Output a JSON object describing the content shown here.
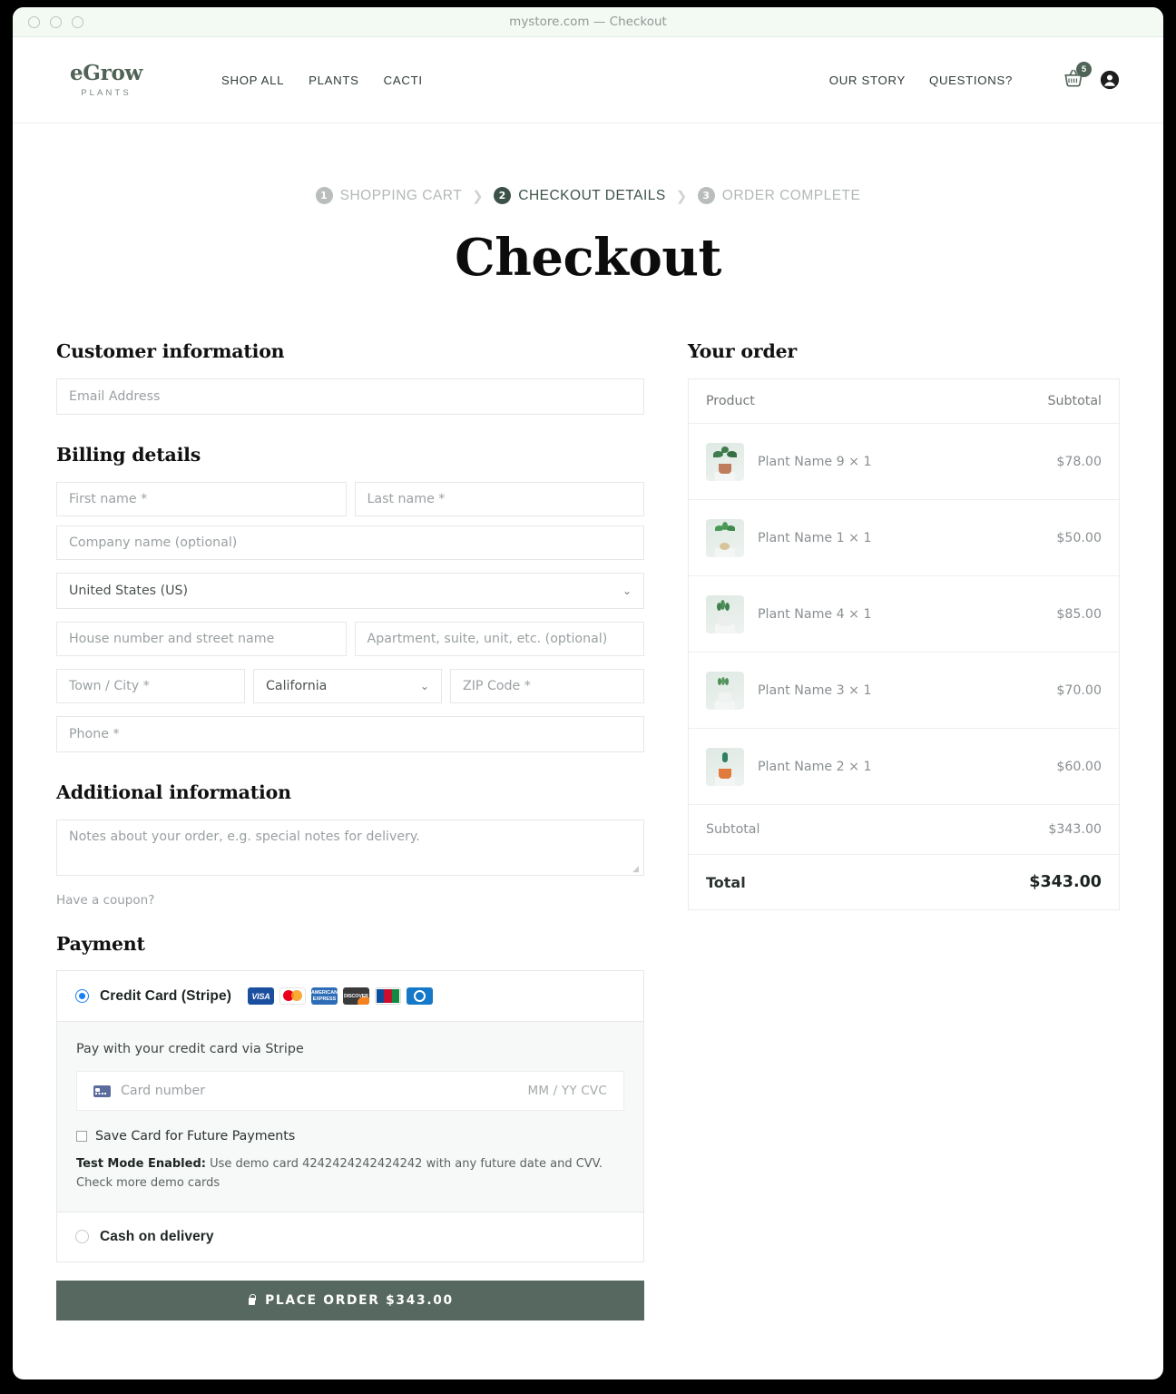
{
  "window": {
    "title": "mystore.com — Checkout"
  },
  "header": {
    "brand_name": "eGrow",
    "brand_sub": "PLANTS",
    "nav_left": [
      "SHOP ALL",
      "PLANTS",
      "CACTI"
    ],
    "nav_right": [
      "OUR STORY",
      "QUESTIONS?"
    ],
    "cart_count": "5"
  },
  "steps": [
    {
      "num": "1",
      "label": "SHOPPING CART",
      "active": false
    },
    {
      "num": "2",
      "label": "CHECKOUT DETAILS",
      "active": true
    },
    {
      "num": "3",
      "label": "ORDER COMPLETE",
      "active": false
    }
  ],
  "page_title": "Checkout",
  "customer": {
    "heading": "Customer information",
    "email_placeholder": "Email Address",
    "email_value": ""
  },
  "billing": {
    "heading": "Billing details",
    "first_name": "First name *",
    "last_name": "Last name *",
    "company": "Company name (optional)",
    "country": "United States (US)",
    "street": "House number and street name",
    "apartment": "Apartment, suite, unit, etc. (optional)",
    "city": "Town / City *",
    "state": "California",
    "zip": "ZIP Code *",
    "phone": "Phone *"
  },
  "additional": {
    "heading": "Additional information",
    "notes_placeholder": "Notes about your order, e.g. special notes for delivery.",
    "coupon_link": "Have a coupon?"
  },
  "payment": {
    "heading": "Payment",
    "method_stripe": "Credit Card (Stripe)",
    "card_brands": [
      "visa-icon",
      "mastercard-icon",
      "amex-icon",
      "discover-icon",
      "jcb-icon",
      "diners-icon"
    ],
    "stripe_desc": "Pay with your credit card via Stripe",
    "card_number_placeholder": "Card number",
    "expiry_cvc": "MM / YY  CVC",
    "save_card_label": "Save Card for Future Payments",
    "test_mode_bold": "Test Mode Enabled:",
    "test_mode_text": " Use demo card 4242424242424242 with any future date and CVV. Check more demo cards",
    "method_cod": "Cash on delivery",
    "place_order_label": "PLACE ORDER $343.00"
  },
  "order": {
    "heading": "Your order",
    "col_product": "Product",
    "col_subtotal": "Subtotal",
    "items": [
      {
        "name": "Plant Name 9 × 1",
        "price": "$78.00",
        "pot": "#c07d5e",
        "leaf": "#3f7d4e"
      },
      {
        "name": "Plant Name 1 × 1",
        "price": "$50.00",
        "pot": "#d8c49a",
        "leaf": "#4a9a57"
      },
      {
        "name": "Plant Name 4 × 1",
        "price": "$85.00",
        "pot": "#e8eae9",
        "leaf": "#4e8f5a"
      },
      {
        "name": "Plant Name 3 × 1",
        "price": "$70.00",
        "pot": "#eceeed",
        "leaf": "#5a9c61"
      },
      {
        "name": "Plant Name 2 × 1",
        "price": "$60.00",
        "pot": "#e07b3c",
        "leaf": "#2f7f63"
      }
    ],
    "subtotal_label": "Subtotal",
    "subtotal_value": "$343.00",
    "total_label": "Total",
    "total_value": "$343.00"
  },
  "colors": {
    "brand_green": "#4f6357",
    "button_green": "#56685f",
    "active_step": "#3c5248"
  }
}
